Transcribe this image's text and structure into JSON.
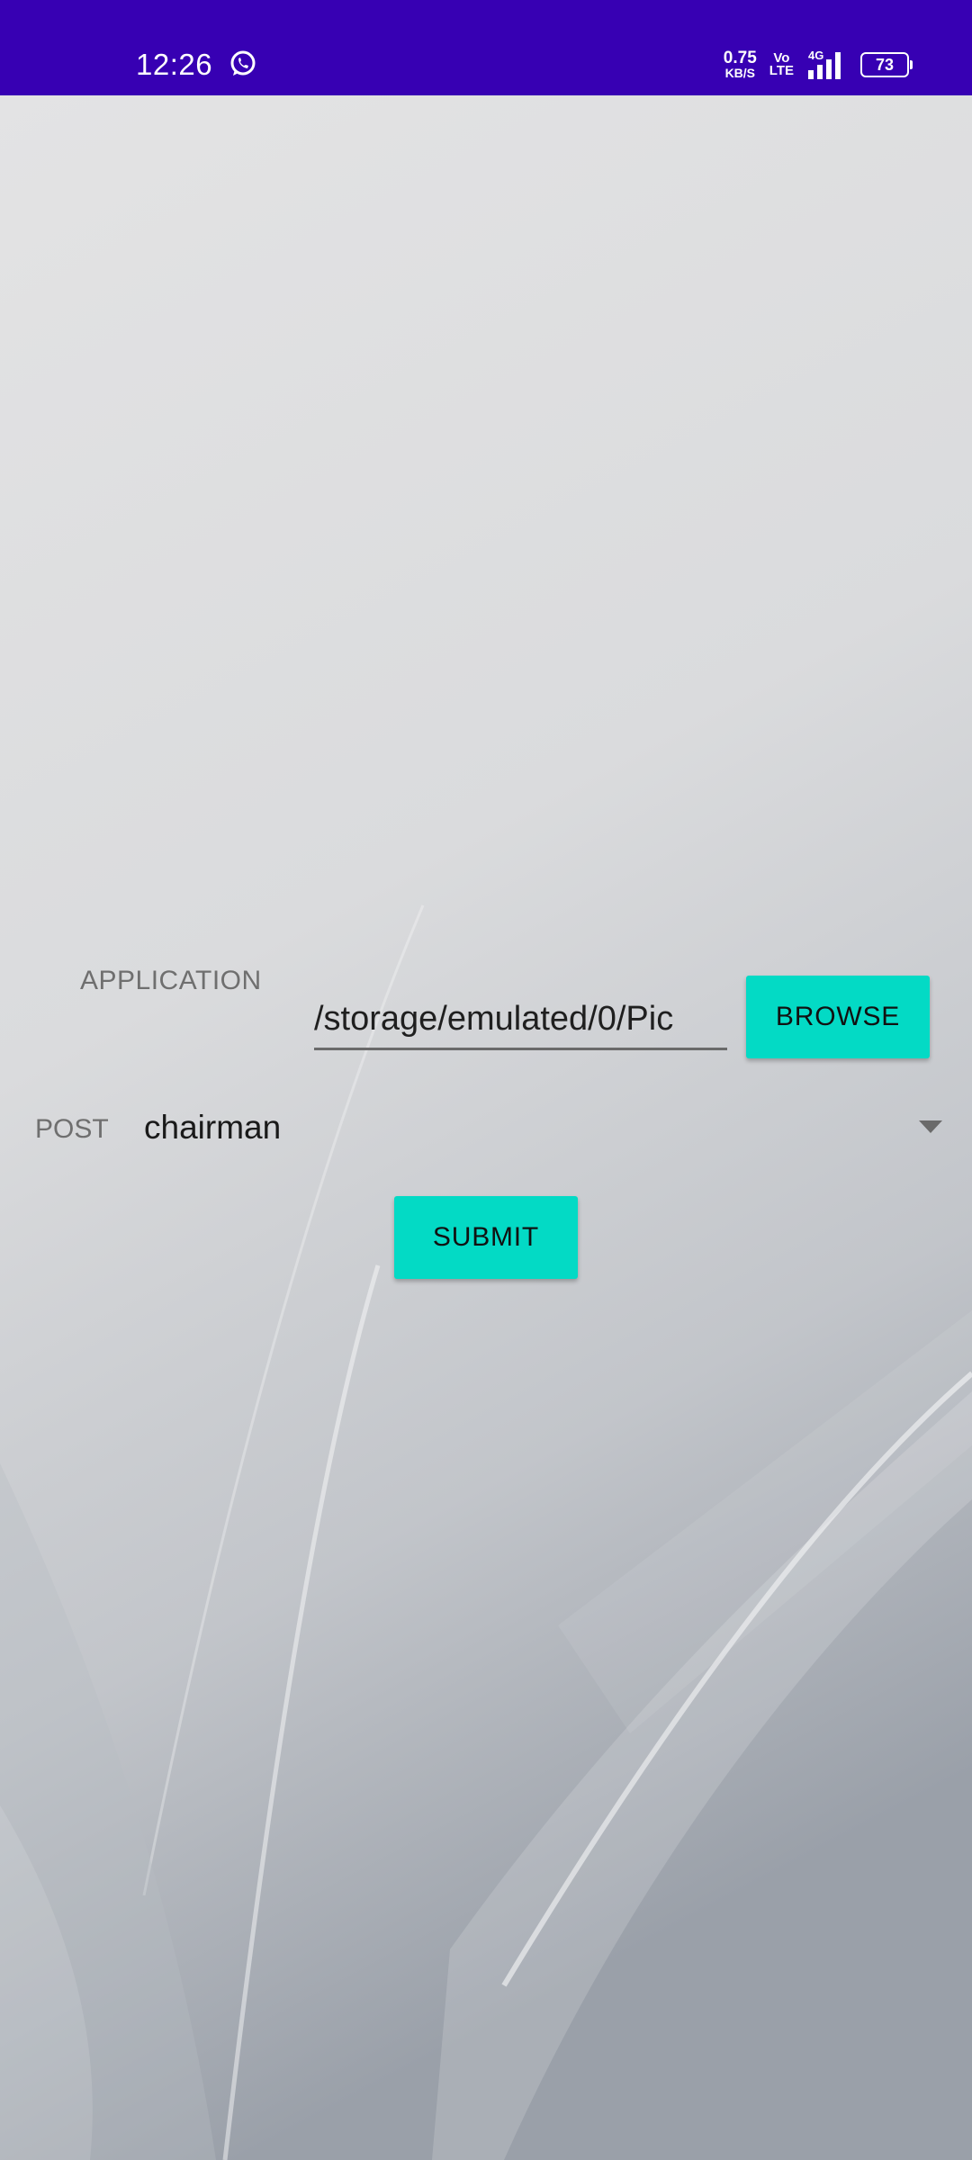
{
  "status_bar": {
    "time": "12:26",
    "speed_value": "0.75",
    "speed_unit": "KB/S",
    "volte_top": "Vo",
    "volte_bottom": "LTE",
    "network": "4G",
    "battery": "73",
    "icons": [
      "whatsapp-icon",
      "signal-icon",
      "battery-icon"
    ]
  },
  "form": {
    "application_label": "APPLICATION",
    "file_path_value": "/storage/emulated/0/Pic",
    "browse_label": "BROWSE",
    "post_label": "POST",
    "post_selected": "chairman",
    "submit_label": "SUBMIT"
  },
  "colors": {
    "status_bar": "#3700b3",
    "accent": "#03dac5"
  }
}
